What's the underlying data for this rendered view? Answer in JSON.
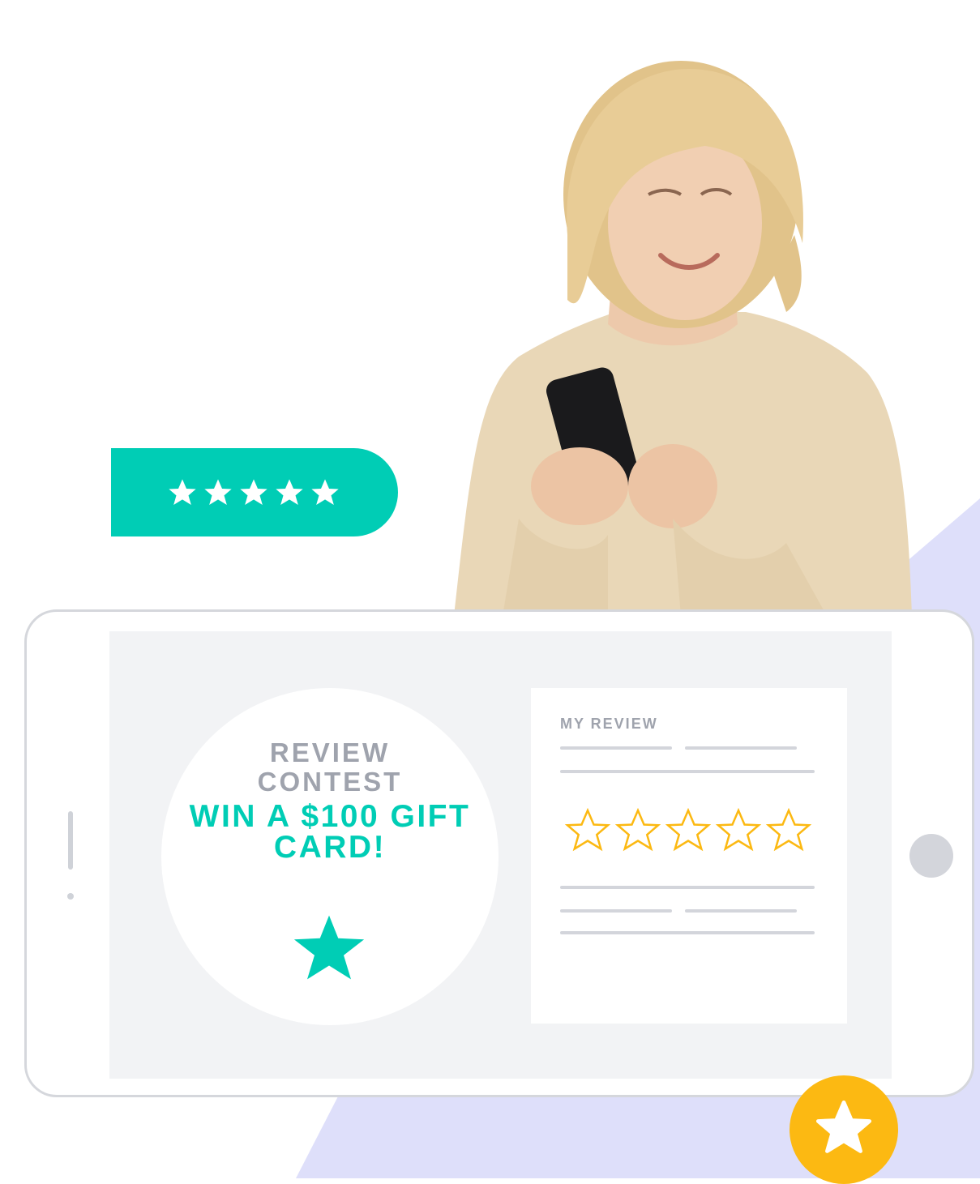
{
  "rating_pill": {
    "rating": 5,
    "icon": "star-icon",
    "color": "#00cdb5"
  },
  "contest": {
    "title": "REVIEW CONTEST",
    "prize": "WIN A $100 GIFT CARD!",
    "icon": "star-icon",
    "accent_color": "#00cdb5"
  },
  "review_card": {
    "heading": "MY REVIEW",
    "star_rating_outline_count": 5,
    "star_color": "#fcb912"
  },
  "badge": {
    "icon": "star-icon",
    "color": "#fcb912"
  },
  "colors": {
    "background_shape": "#dedffa",
    "phone_border": "#d5d7dc",
    "screen": "#f2f3f5"
  }
}
